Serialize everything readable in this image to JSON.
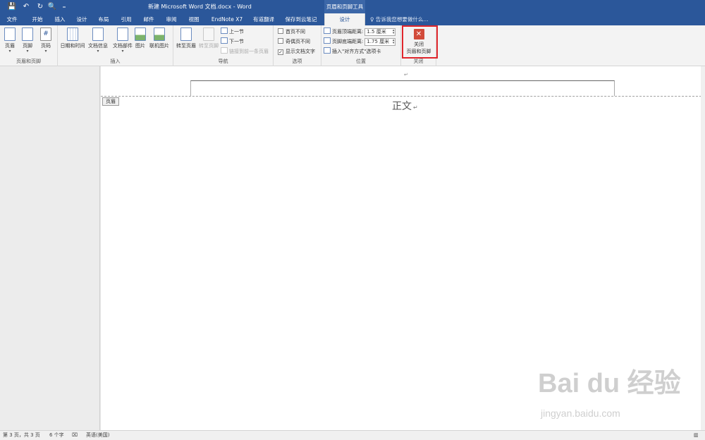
{
  "titlebar": {
    "title": "新建 Microsoft Word 文档.docx - Word",
    "context_tab_title": "页眉和页脚工具",
    "quick_access": [
      {
        "icon": "save-icon",
        "glyph": "💾"
      },
      {
        "icon": "undo-icon",
        "glyph": "↶"
      },
      {
        "icon": "redo-icon",
        "glyph": "↻"
      },
      {
        "icon": "print-preview-icon",
        "glyph": "🔍"
      },
      {
        "icon": "customize-qat-icon",
        "glyph": "₌"
      }
    ]
  },
  "tabs": [
    {
      "label": "文件"
    },
    {
      "label": "开始"
    },
    {
      "label": "插入"
    },
    {
      "label": "设计"
    },
    {
      "label": "布局"
    },
    {
      "label": "引用"
    },
    {
      "label": "邮件"
    },
    {
      "label": "审阅"
    },
    {
      "label": "视图"
    },
    {
      "label": "EndNote X7"
    },
    {
      "label": "有道翻译"
    },
    {
      "label": "保存到云笔记"
    },
    {
      "label": "设计",
      "active": true
    }
  ],
  "tell_me": "告诉我您想要做什么...",
  "ribbon": {
    "header_footer": {
      "group_label": "页眉和页脚",
      "header": "页眉",
      "footer": "页脚",
      "page_number": "页码"
    },
    "insert": {
      "group_label": "插入",
      "date_time": "日期和时间",
      "doc_info": "文档信息",
      "doc_parts": "文档部件",
      "picture": "图片",
      "online_picture": "联机图片"
    },
    "navigation": {
      "group_label": "导航",
      "goto_header": "转至页眉",
      "goto_footer": "转至页脚",
      "prev_section": "上一节",
      "next_section": "下一节",
      "link_previous": "链接到前一条页眉"
    },
    "options": {
      "group_label": "选项",
      "first_page_diff": "首页不同",
      "odd_even_diff": "奇偶页不同",
      "show_doc_text": "显示文档文字",
      "show_doc_text_checked": "✓"
    },
    "position": {
      "group_label": "位置",
      "header_top_label": "页眉顶端距离:",
      "header_top_value": "1.5 厘米",
      "footer_bottom_label": "页脚底端距离:",
      "footer_bottom_value": "1.75 厘米",
      "insert_align_tab": "插入\"对齐方式\"选项卡"
    },
    "close": {
      "group_label": "关闭",
      "close_line1": "关闭",
      "close_line2": "页眉和页脚",
      "close_glyph": "✕",
      "accent": "#d24b3a",
      "highlight_color": "#e0262c"
    }
  },
  "document": {
    "header_tag": "页眉",
    "paragraph_mark": "↵",
    "body_text": "正文",
    "watermark": "Bai du 经验",
    "watermark_sub": "jingyan.baidu.com"
  },
  "statusbar": {
    "page": "第 3 页，共 3 页",
    "words": "6 个字",
    "language": "英语(美国)",
    "view_icon": "read-mode-icon"
  },
  "colors": {
    "word_blue": "#2b579a",
    "ribbon_bg": "#f3f3f3"
  }
}
